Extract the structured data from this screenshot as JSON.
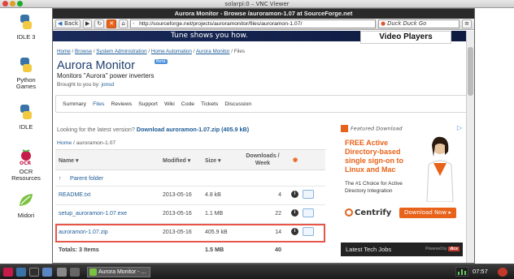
{
  "vnc": {
    "title": "solarpi:0 – VNC Viewer"
  },
  "desktop": {
    "icons": [
      {
        "label": "IDLE 3",
        "icon": "python-icon"
      },
      {
        "label": "Python Games",
        "icon": "python-icon"
      },
      {
        "label": "IDLE",
        "icon": "python-icon"
      },
      {
        "label": "OCR Resources",
        "icon": "raspberry-icon"
      },
      {
        "label": "Midori",
        "icon": "midori-icon"
      }
    ]
  },
  "browser": {
    "title": "Aurora Monitor - Browse /auroramon-1.07 at SourceForge.net",
    "back_label": "Back",
    "url": "http://sourceforge.net/projects/auroramonitor/files/auroramon-1.07/",
    "search_placeholder": "Duck Duck Go"
  },
  "page": {
    "video_players": "Video Players",
    "ad_strip_text": "Tune shows you how.",
    "breadcrumbs": [
      "Home",
      "Browse",
      "System Administration",
      "Home Automation",
      "Aurora Monitor",
      "Files"
    ],
    "project_title": "Aurora Monitor",
    "beta_badge": "Beta",
    "tagline": "Monitors \"Aurora\" power inverters",
    "brought_prefix": "Brought to you by:",
    "brought_user": "jonsd",
    "tabs": [
      "Summary",
      "Files",
      "Reviews",
      "Support",
      "Wiki",
      "Code",
      "Tickets",
      "Discussion"
    ],
    "latest_prefix": "Looking for the latest version?",
    "latest_link": "Download auroramon-1.07.zip (405.9 kB)",
    "path": [
      "Home",
      "auroramon-1.07"
    ],
    "table": {
      "headers": {
        "name": "Name ▾",
        "modified": "Modified ▾",
        "size": "Size ▾",
        "downloads": "Downloads / Week"
      },
      "parent": "Parent folder",
      "rows": [
        {
          "name": "README.txt",
          "modified": "2013-05-16",
          "size": "4.8 kB",
          "downloads": "4"
        },
        {
          "name": "setup_auroramon-1.07.exe",
          "modified": "2013-05-16",
          "size": "1.1 MB",
          "downloads": "22"
        },
        {
          "name": "auroramon-1.07.zip",
          "modified": "2013-05-16",
          "size": "405.9 kB",
          "downloads": "14"
        }
      ],
      "totals": {
        "label": "Totals: 3 Items",
        "size": "1.5 MB",
        "downloads": "40"
      }
    },
    "ad": {
      "featured": "Featured Download",
      "headline": "FREE Active Directory-based single sign-on to Linux and Mac",
      "sub": "The #1 Choice for Active Directory Integration",
      "brand": "Centrify",
      "download": "Download Now ▸"
    },
    "jobs": {
      "label": "Latest Tech Jobs",
      "powered": "Powered by",
      "powered_brand": "dice"
    }
  },
  "taskbar": {
    "task_label": "Aurora Monitor - ...",
    "clock": "07:57"
  }
}
